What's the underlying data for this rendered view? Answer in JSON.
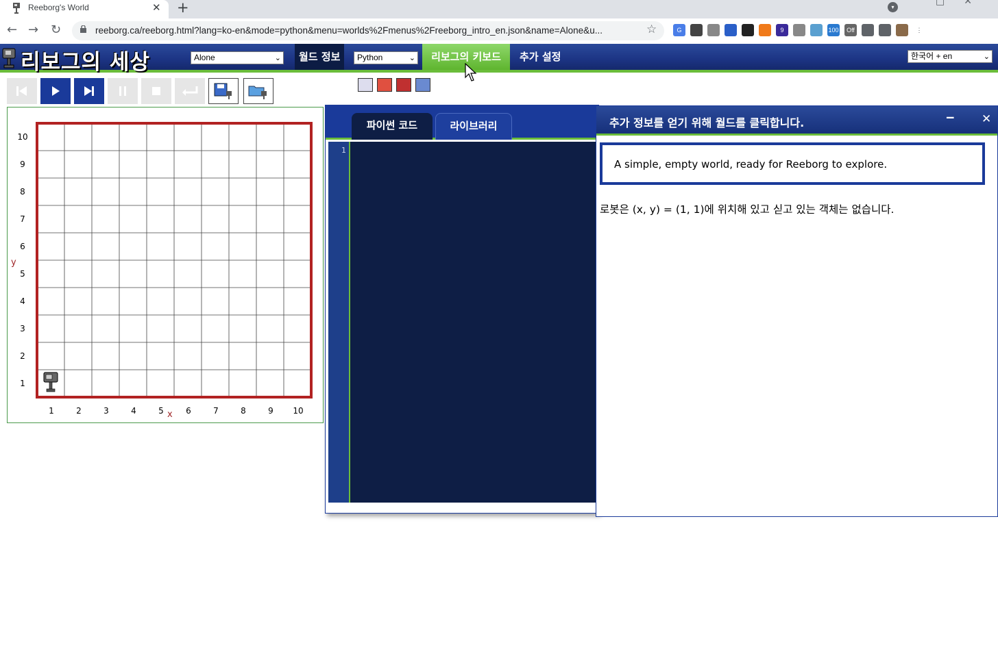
{
  "browser": {
    "tab_title": "Reeborg's World",
    "tab_close": "✕",
    "new_tab": "+",
    "url": "reeborg.ca/reeborg.html?lang=ko-en&mode=python&menu=worlds%2Fmenus%2Freeborg_intro_en.json&name=Alone&u...",
    "back": "←",
    "forward": "→",
    "reload": "↻",
    "star": "☆",
    "extensions": [
      {
        "name": "translate-ext",
        "color": "#4a7ee8",
        "label": "G"
      },
      {
        "name": "eyedropper-ext",
        "color": "#444444",
        "label": ""
      },
      {
        "name": "brush-ext",
        "color": "#888888",
        "label": ""
      },
      {
        "name": "cap-ext",
        "color": "#2a5fc8",
        "label": ""
      },
      {
        "name": "cursor-ext",
        "color": "#222222",
        "label": ""
      },
      {
        "name": "rss-ext",
        "color": "#f07a1a",
        "label": ""
      },
      {
        "name": "badge-ext",
        "color": "#3a2a9a",
        "label": "9"
      },
      {
        "name": "reader-ext",
        "color": "#888888",
        "label": ""
      },
      {
        "name": "window-ext",
        "color": "#5aa0d0",
        "label": ""
      },
      {
        "name": "counter-ext",
        "color": "#2a7ad0",
        "label": "100"
      },
      {
        "name": "off-ext",
        "color": "#666666",
        "label": "Off"
      },
      {
        "name": "puzzle-ext",
        "color": "#5f6368",
        "label": ""
      },
      {
        "name": "media-ext",
        "color": "#5f6368",
        "label": ""
      },
      {
        "name": "profile-ext",
        "color": "#8a6a4a",
        "label": ""
      },
      {
        "name": "menu-ext",
        "color": "#ffffff",
        "label": "⋮"
      }
    ]
  },
  "header": {
    "logo_text": "리보그의 세상",
    "world_select": "Alone",
    "world_info": "월드 정보",
    "language_select": "Python",
    "keyboard": "리보그의 키보드",
    "settings": "추가 설정",
    "ui_lang_select": "한국어 + en"
  },
  "editor": {
    "tab_python": "파이썬 코드",
    "tab_library": "라이브러리",
    "line_number": "1"
  },
  "world": {
    "rows": 10,
    "cols": 10,
    "robot_x": 1,
    "robot_y": 1,
    "x_axis_label": "x",
    "y_axis_label": "y",
    "x_ticks": [
      "1",
      "2",
      "3",
      "4",
      "5",
      "6",
      "7",
      "8",
      "9",
      "10"
    ],
    "y_ticks": [
      "1",
      "2",
      "3",
      "4",
      "5",
      "6",
      "7",
      "8",
      "9",
      "10"
    ],
    "border_color": "#b22222",
    "panel_border_color": "#4a9a4a"
  },
  "info": {
    "title": "추가 정보를 얻기 위해 월드를 클릭합니다.",
    "minimize": "‒",
    "close": "✕",
    "description": "A simple, empty world, ready for Reeborg to explore.",
    "robot_status": "로봇은 (x, y) = (1, 1)에 위치해 있고 싣고 있는 객체는 없습니다."
  },
  "colors": {
    "accent_blue": "#1a3a9a",
    "accent_green": "#6bbd3a",
    "editor_bg": "#0e1e45"
  }
}
